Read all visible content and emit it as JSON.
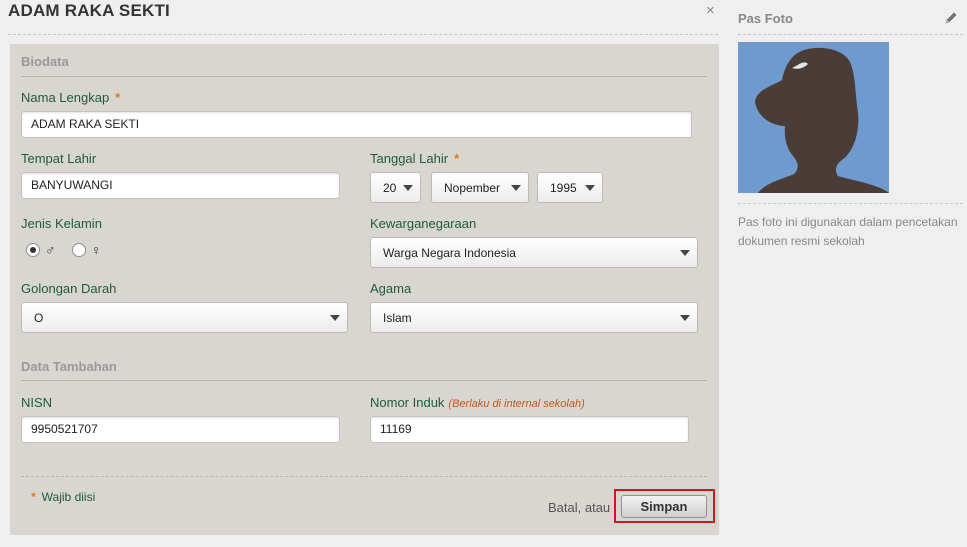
{
  "window": {
    "title": "ADAM RAKA SEKTI",
    "close_glyph": "×"
  },
  "form": {
    "biodata_title": "Biodata",
    "nama_lengkap": {
      "label": "Nama Lengkap",
      "value": "ADAM RAKA SEKTI",
      "required": "*"
    },
    "tempat_lahir": {
      "label": "Tempat Lahir",
      "value": "BANYUWANGI"
    },
    "tanggal_lahir": {
      "label": "Tanggal Lahir",
      "required": "*",
      "day": "20",
      "month": "Nopember",
      "year": "1995"
    },
    "jenis_kelamin": {
      "label": "Jenis Kelamin",
      "male_symbol": "♂",
      "female_symbol": "♀",
      "selected": "male"
    },
    "kewarganegaraan": {
      "label": "Kewarganegaraan",
      "value": "Warga Negara Indonesia"
    },
    "golongan_darah": {
      "label": "Golongan Darah",
      "value": "O"
    },
    "agama": {
      "label": "Agama",
      "value": "Islam"
    },
    "tambahan_title": "Data Tambahan",
    "nisn": {
      "label": "NISN",
      "value": "9950521707"
    },
    "nomor_induk": {
      "label": "Nomor Induk",
      "hint": "(Berlaku di internal sekolah)",
      "value": "11169"
    },
    "footer": {
      "required_star": "*",
      "required_note": "Wajib diisi",
      "cancel_text": "Batal, atau",
      "save_label": "Simpan"
    }
  },
  "sidebar": {
    "title": "Pas Foto",
    "photo_icon": "person-silhouette",
    "edit_icon": "pencil-icon",
    "description": "Pas foto ini digunakan dalam pencetakan dokumen resmi sekolah"
  },
  "colors": {
    "panel_bg": "#d9d6d1",
    "label_green": "#1d5b3c",
    "required_orange": "#e07b1e",
    "highlight_red": "#d0151d",
    "photo_bg": "#6f9acd"
  }
}
